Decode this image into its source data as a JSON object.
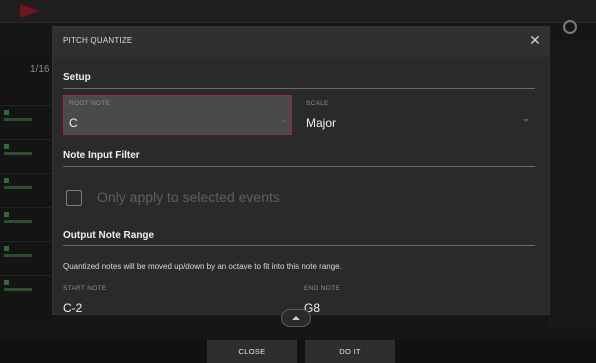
{
  "background": {
    "quantize_readout": "1/16"
  },
  "dialog": {
    "title": "PITCH QUANTIZE",
    "close_icon": "close-icon",
    "setup": {
      "heading": "Setup",
      "root_note_label": "ROOT NOTE",
      "root_note_value": "C",
      "scale_label": "SCALE",
      "scale_value": "Major"
    },
    "note_input_filter": {
      "heading": "Note Input Filter",
      "checkbox_label": "Only apply to selected events",
      "checked": false
    },
    "output_note_range": {
      "heading": "Output Note Range",
      "info": "Quantized notes will be moved up/down by an octave to fit into this note range.",
      "start_note_label": "START NOTE",
      "start_note_value": "C-2",
      "end_note_label": "END NOTE",
      "end_note_value": "G8"
    }
  },
  "buttons": {
    "close_label": "CLOSE",
    "do_it_label": "DO IT"
  },
  "colors": {
    "accent_border": "#9c2a3a",
    "dialog_bg": "#2a2a2a",
    "selected_field_bg": "#4a4a4a"
  }
}
